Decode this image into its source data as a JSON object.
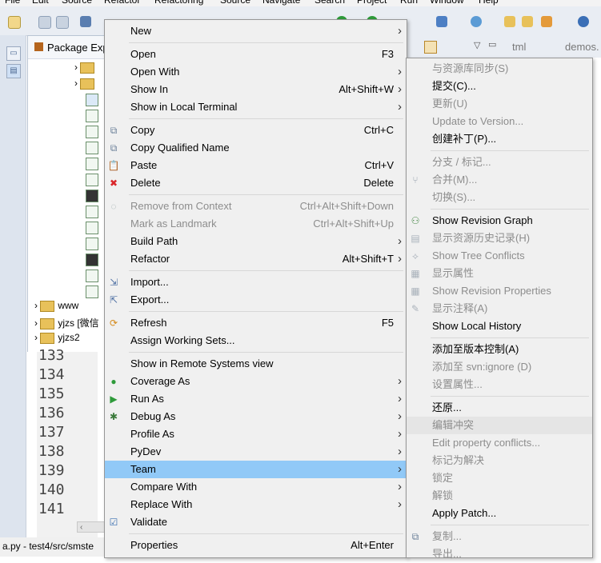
{
  "menubar": [
    "File",
    "Edit",
    "Source",
    "Refactor",
    "Refactoring",
    "Source",
    "Navigate",
    "Search",
    "Project",
    "Run",
    "Window",
    "Help"
  ],
  "package_explorer": {
    "title": "Package Exp",
    "projects": [
      "www",
      "yjzs [微信",
      "yjzs2"
    ]
  },
  "editor": {
    "line_numbers": [
      "133",
      "134",
      "135",
      "136",
      "137",
      "138",
      "139",
      "140",
      "141"
    ]
  },
  "right_tabs": [
    "tml",
    "demos."
  ],
  "status_text": "a.py - test4/src/smste",
  "context_menu": {
    "items": [
      {
        "label": "New",
        "shortcut": "",
        "submenu": true,
        "icon": "",
        "disabled": false
      },
      {
        "label": "Open",
        "shortcut": "F3",
        "submenu": false,
        "icon": "",
        "disabled": false
      },
      {
        "label": "Open With",
        "shortcut": "",
        "submenu": true,
        "icon": "",
        "disabled": false
      },
      {
        "label": "Show In",
        "shortcut": "Alt+Shift+W",
        "submenu": true,
        "icon": "",
        "disabled": false
      },
      {
        "label": "Show in Local Terminal",
        "shortcut": "",
        "submenu": true,
        "icon": "",
        "disabled": false
      },
      {
        "label": "Copy",
        "shortcut": "Ctrl+C",
        "submenu": false,
        "icon": "copy-icon",
        "disabled": false
      },
      {
        "label": "Copy Qualified Name",
        "shortcut": "",
        "submenu": false,
        "icon": "copy-qualified-icon",
        "disabled": false
      },
      {
        "label": "Paste",
        "shortcut": "Ctrl+V",
        "submenu": false,
        "icon": "paste-icon",
        "disabled": false
      },
      {
        "label": "Delete",
        "shortcut": "Delete",
        "submenu": false,
        "icon": "delete-icon",
        "disabled": false
      },
      {
        "label": "Remove from Context",
        "shortcut": "Ctrl+Alt+Shift+Down",
        "submenu": false,
        "icon": "remove-context-icon",
        "disabled": true
      },
      {
        "label": "Mark as Landmark",
        "shortcut": "Ctrl+Alt+Shift+Up",
        "submenu": false,
        "icon": "",
        "disabled": true
      },
      {
        "label": "Build Path",
        "shortcut": "",
        "submenu": true,
        "icon": "",
        "disabled": false
      },
      {
        "label": "Refactor",
        "shortcut": "Alt+Shift+T",
        "submenu": true,
        "icon": "",
        "disabled": false
      },
      {
        "label": "Import...",
        "shortcut": "",
        "submenu": false,
        "icon": "import-icon",
        "disabled": false
      },
      {
        "label": "Export...",
        "shortcut": "",
        "submenu": false,
        "icon": "export-icon",
        "disabled": false
      },
      {
        "label": "Refresh",
        "shortcut": "F5",
        "submenu": false,
        "icon": "refresh-icon",
        "disabled": false
      },
      {
        "label": "Assign Working Sets...",
        "shortcut": "",
        "submenu": false,
        "icon": "",
        "disabled": false
      },
      {
        "label": "Show in Remote Systems view",
        "shortcut": "",
        "submenu": false,
        "icon": "",
        "disabled": false
      },
      {
        "label": "Coverage As",
        "shortcut": "",
        "submenu": true,
        "icon": "coverage-icon",
        "disabled": false
      },
      {
        "label": "Run As",
        "shortcut": "",
        "submenu": true,
        "icon": "run-icon",
        "disabled": false
      },
      {
        "label": "Debug As",
        "shortcut": "",
        "submenu": true,
        "icon": "debug-icon",
        "disabled": false
      },
      {
        "label": "Profile As",
        "shortcut": "",
        "submenu": true,
        "icon": "",
        "disabled": false
      },
      {
        "label": "PyDev",
        "shortcut": "",
        "submenu": true,
        "icon": "",
        "disabled": false
      },
      {
        "label": "Team",
        "shortcut": "",
        "submenu": true,
        "icon": "",
        "disabled": false,
        "selected": true
      },
      {
        "label": "Compare With",
        "shortcut": "",
        "submenu": true,
        "icon": "",
        "disabled": false
      },
      {
        "label": "Replace With",
        "shortcut": "",
        "submenu": true,
        "icon": "",
        "disabled": false
      },
      {
        "label": "Validate",
        "shortcut": "",
        "submenu": false,
        "icon": "check-icon",
        "disabled": false
      },
      {
        "label": "Properties",
        "shortcut": "Alt+Enter",
        "submenu": false,
        "icon": "",
        "disabled": false
      }
    ]
  },
  "team_submenu": {
    "items": [
      {
        "label": "与资源库同步(S)",
        "disabled": true,
        "icon": ""
      },
      {
        "label": "提交(C)...",
        "disabled": false,
        "icon": ""
      },
      {
        "label": "更新(U)",
        "disabled": true,
        "icon": ""
      },
      {
        "label": "Update to Version...",
        "disabled": true,
        "icon": ""
      },
      {
        "label": "创建补丁(P)...",
        "disabled": false,
        "icon": ""
      },
      {
        "label": "分支 / 标记...",
        "disabled": true,
        "icon": ""
      },
      {
        "label": "合并(M)...",
        "disabled": true,
        "icon": "merge-icon"
      },
      {
        "label": "切换(S)...",
        "disabled": true,
        "icon": ""
      },
      {
        "label": "Show Revision Graph",
        "disabled": false,
        "icon": "revision-graph-icon"
      },
      {
        "label": "显示资源历史记录(H)",
        "disabled": true,
        "icon": "history-icon"
      },
      {
        "label": "Show Tree Conflicts",
        "disabled": true,
        "icon": "tree-conflicts-icon"
      },
      {
        "label": "显示属性",
        "disabled": true,
        "icon": "properties-icon"
      },
      {
        "label": "Show Revision Properties",
        "disabled": true,
        "icon": "revision-properties-icon"
      },
      {
        "label": "显示注释(A)",
        "disabled": true,
        "icon": "annotate-icon"
      },
      {
        "label": "Show Local History",
        "disabled": false,
        "icon": ""
      },
      {
        "label": "添加至版本控制(A)",
        "disabled": false,
        "icon": ""
      },
      {
        "label": "添加至 svn:ignore (D)",
        "disabled": true,
        "icon": ""
      },
      {
        "label": "设置属性...",
        "disabled": true,
        "icon": ""
      },
      {
        "label": "还原...",
        "disabled": false,
        "icon": ""
      },
      {
        "label": "编辑冲突",
        "disabled": true,
        "icon": "",
        "hover": true
      },
      {
        "label": "Edit property conflicts...",
        "disabled": true,
        "icon": ""
      },
      {
        "label": "标记为解决",
        "disabled": true,
        "icon": ""
      },
      {
        "label": "锁定",
        "disabled": true,
        "icon": ""
      },
      {
        "label": "解锁",
        "disabled": true,
        "icon": ""
      },
      {
        "label": "Apply Patch...",
        "disabled": false,
        "icon": ""
      },
      {
        "label": "复制...",
        "disabled": true,
        "icon": "copy-icon"
      },
      {
        "label": "导出...",
        "disabled": true,
        "icon": ""
      }
    ]
  },
  "colors": {
    "menu_bg": "#f0f0f0",
    "selected_bg": "#91c9f7",
    "disabled_text": "#8d8d8d",
    "delete_red": "#d9262a",
    "run_green": "#2e9a3a"
  }
}
